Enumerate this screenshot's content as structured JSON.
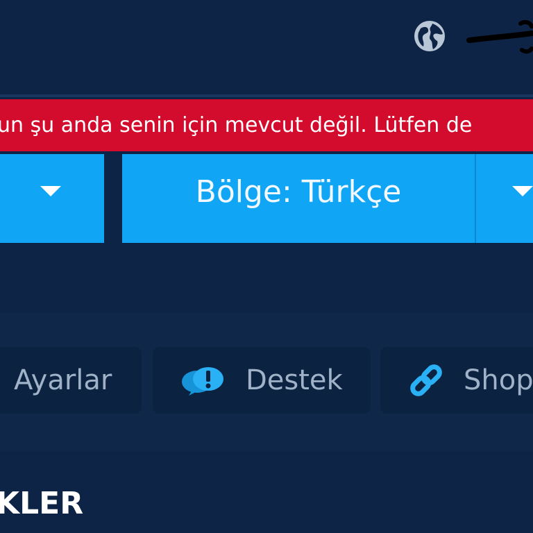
{
  "header": {
    "globe_icon": "globe-icon",
    "redacted_icon": "user-icon"
  },
  "alert": {
    "text": "un şu anda senin için mevcut değil. Lütfen de",
    "color": "#d30c2d"
  },
  "region_select": {
    "label": "Bölge: Türkçe",
    "color": "#11a6f5"
  },
  "nav": {
    "settings_label": "Ayarlar",
    "support_label": "Destek",
    "shop_label": "Shop"
  },
  "section": {
    "title": "KLER"
  }
}
